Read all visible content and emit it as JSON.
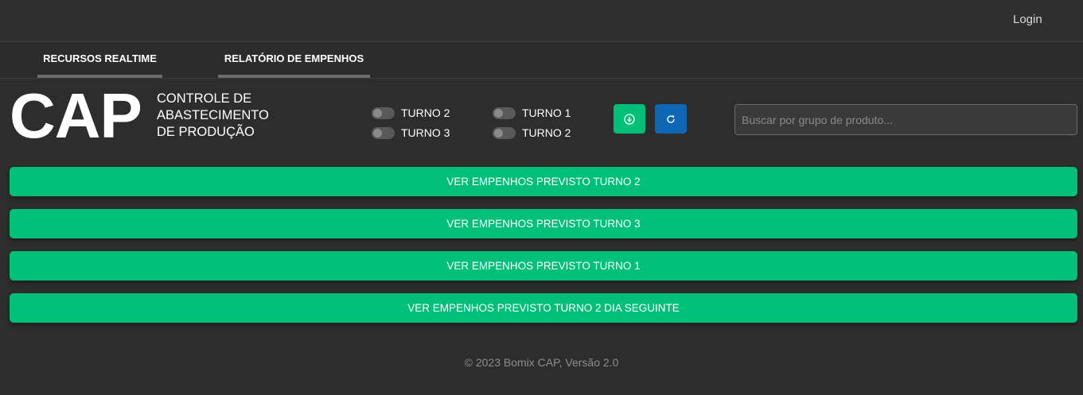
{
  "header": {
    "login_label": "Login"
  },
  "nav": {
    "tabs": [
      {
        "label": "RECURSOS REALTIME"
      },
      {
        "label": "RELATÓRIO DE EMPENHOS"
      }
    ]
  },
  "brand": {
    "logo": "CAP",
    "subtitle_lines": [
      "CONTROLE DE",
      "ABASTECIMENTO",
      "DE PRODUÇÃO"
    ]
  },
  "toggles": [
    {
      "label": "TURNO 2",
      "checked": false
    },
    {
      "label": "TURNO 3",
      "checked": false
    },
    {
      "label": "TURNO 1",
      "checked": false
    },
    {
      "label": "TURNO 2",
      "checked": false
    }
  ],
  "toolbar": {
    "download_icon": "download-circle-icon",
    "refresh_icon": "refresh-icon"
  },
  "search": {
    "placeholder": "Buscar por grupo de produto...",
    "value": ""
  },
  "actions": [
    {
      "label": "VER EMPENHOS PREVISTO TURNO 2"
    },
    {
      "label": "VER EMPENHOS PREVISTO TURNO 3"
    },
    {
      "label": "VER EMPENHOS PREVISTO TURNO 1"
    },
    {
      "label": "VER EMPENHOS PREVISTO TURNO 2 DIA SEGUINTE"
    }
  ],
  "footer": {
    "text": "© 2023 Bomix CAP, Versão 2.0"
  },
  "colors": {
    "background": "#2e2d2d",
    "accent_green": "#00bf78",
    "accent_blue": "#0d67b5"
  }
}
